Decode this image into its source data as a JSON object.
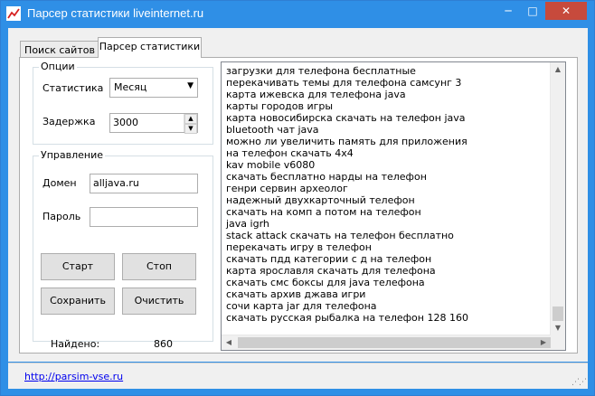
{
  "window": {
    "title": "Парсер статистики liveinternet.ru",
    "controls": {
      "minimize": "─",
      "maximize": "□",
      "close": "✕"
    }
  },
  "tabs": [
    {
      "label": "Поиск сайтов"
    },
    {
      "label": "Парсер статистики"
    }
  ],
  "options": {
    "legend": "Опции",
    "stat_label": "Статистика",
    "stat_value": "Месяц",
    "delay_label": "Задержка",
    "delay_value": "3000"
  },
  "control": {
    "legend": "Управление",
    "domain_label": "Домен",
    "domain_value": "alljava.ru",
    "password_label": "Пароль",
    "password_value": "",
    "start": "Старт",
    "stop": "Стоп",
    "save": "Сохранить",
    "clear": "Очистить"
  },
  "found": {
    "label": "Найдено:",
    "value": "860"
  },
  "results": [
    "загрузки для телефона бесплатные",
    "перекачивать темы для телефона самсунг 3",
    "карта ижевска для телефона java",
    "карты городов игры",
    "карта новосибирска скачать на телефон java",
    "bluetooth чат java",
    "можно ли увеличить память для приложения",
    "на телефон скачать 4x4",
    "kav mobile v6080",
    "скачать бесплатно нарды на телефон",
    "генри сервин археолог",
    "надежный двухкарточный телефон",
    "скачать на комп а потом на телефон",
    "java igrh",
    "stack attack скачать на телефон бесплатно",
    "перекачать игру в телефон",
    "скачать пдд категории с д на телефон",
    "карта ярославля скачать для телефона",
    "скачать смс боксы для java телефона",
    "скачать архив джава игри",
    "сочи карта jar для телефона",
    "скачать русская рыбалка на телефон 128 160"
  ],
  "status": {
    "link": "http://parsim-vse.ru"
  },
  "icons": {
    "app": "chart-line-icon",
    "combo": "chevron-down-icon",
    "spin_up": "caret-up-icon",
    "spin_down": "caret-down-icon",
    "scroll_up": "caret-up-icon",
    "scroll_down": "caret-down-icon",
    "scroll_left": "caret-left-icon",
    "scroll_right": "caret-right-icon",
    "grip": "resize-grip-icon"
  },
  "colors": {
    "titlebar": "#2f8fe6",
    "close": "#c74a3c",
    "link": "#0000ee"
  }
}
